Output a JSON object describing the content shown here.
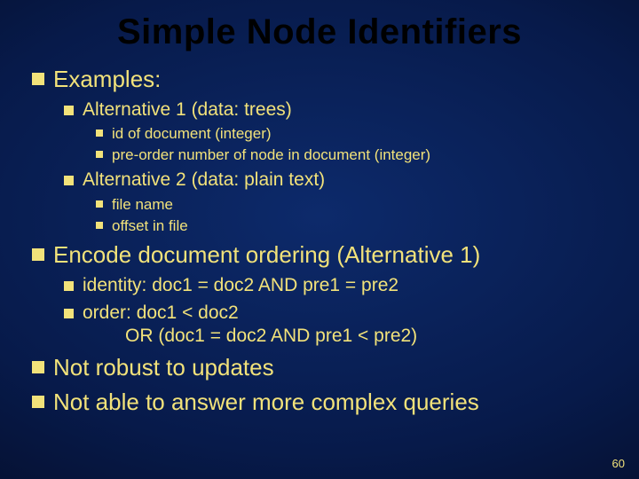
{
  "title": "Simple Node Identifiers",
  "slide_number": "60",
  "b1": {
    "examples": "Examples:",
    "alt1": "Alternative 1 (data: trees)",
    "alt1_a": "id of document  (integer)",
    "alt1_b": "pre-order number of node in document (integer)",
    "alt2": "Alternative 2 (data: plain text)",
    "alt2_a": "file name",
    "alt2_b": "offset in file",
    "encode": "Encode document ordering (Alternative 1)",
    "enc_a": "identity: doc1 = doc2 AND pre1 = pre2",
    "enc_b": "order: doc1 < doc2",
    "enc_b2": "OR (doc1 = doc2 AND pre1 < pre2)",
    "robust": "Not robust to updates",
    "complex": "Not able to answer more complex queries"
  }
}
